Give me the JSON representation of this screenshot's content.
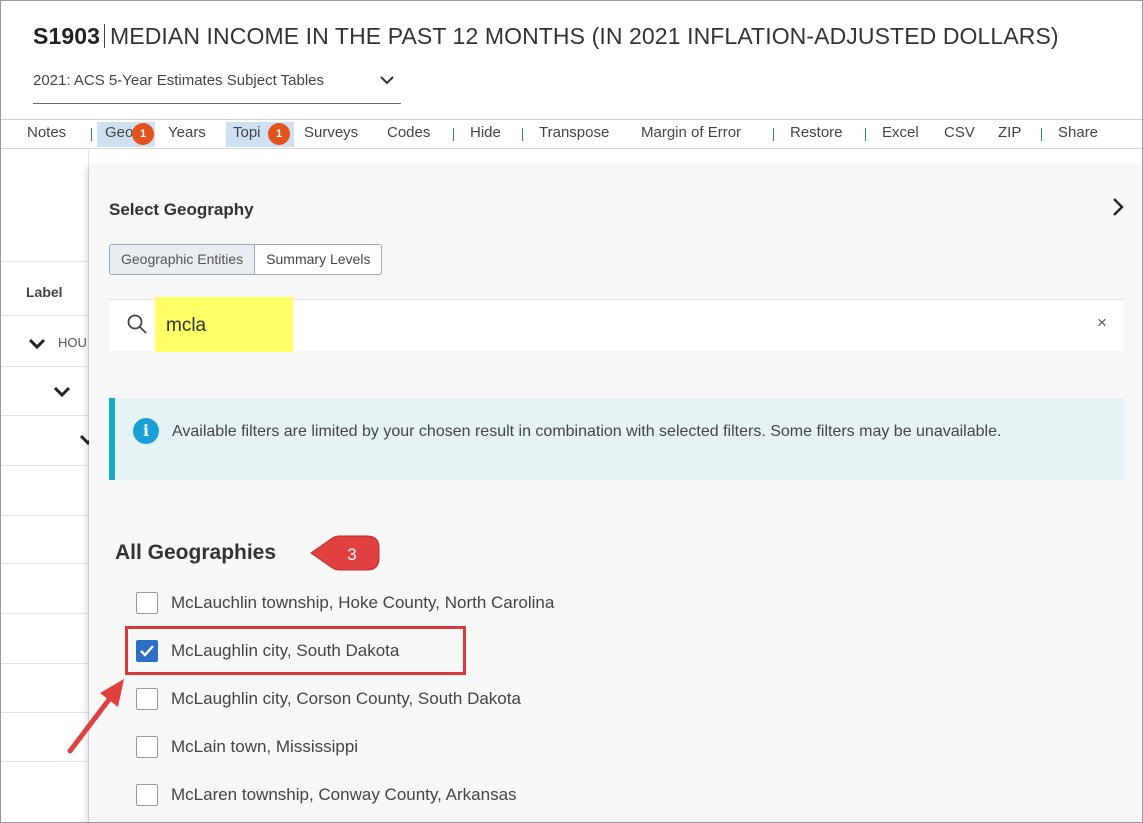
{
  "header": {
    "code": "S1903",
    "title": "MEDIAN INCOME IN THE PAST 12 MONTHS (IN 2021 INFLATION-ADJUSTED DOLLARS)",
    "dataset": "2021: ACS 5-Year Estimates Subject Tables"
  },
  "toolbar": {
    "notes": "Notes",
    "geo": "Geo",
    "geo_badge": "1",
    "years": "Years",
    "topics": "Topi",
    "topics_badge": "1",
    "surveys": "Surveys",
    "codes": "Codes",
    "hide": "Hide",
    "transpose": "Transpose",
    "margin_of_error": "Margin of Error",
    "restore": "Restore",
    "excel": "Excel",
    "csv": "CSV",
    "zip": "ZIP",
    "share": "Share"
  },
  "table_bg": {
    "label_header": "Label",
    "row1": "HOU"
  },
  "panel": {
    "title": "Select Geography",
    "tabs": [
      {
        "label": "Geographic Entities",
        "active": true
      },
      {
        "label": "Summary Levels",
        "active": false
      }
    ],
    "search": {
      "value": "mcla",
      "clear": "×"
    },
    "info": "Available filters are limited by your chosen result in combination with selected filters. Some filters may be unavailable.",
    "info_icon": "i",
    "section_title": "All Geographies",
    "callout_number": "3",
    "items": [
      {
        "label": "McLauchlin township, Hoke County, North Carolina",
        "checked": false
      },
      {
        "label": "McLaughlin city, South Dakota",
        "checked": true
      },
      {
        "label": "McLaughlin city, Corson County, South Dakota",
        "checked": false
      },
      {
        "label": "McLain town, Mississippi",
        "checked": false
      },
      {
        "label": "McLaren township, Conway County, Arkansas",
        "checked": false
      }
    ]
  },
  "colors": {
    "badge": "#e2541b",
    "highlight": "#ffff66",
    "accent_red": "#d63a3a",
    "checkbox_blue": "#2d6fc4",
    "info_border": "#19aac4"
  }
}
